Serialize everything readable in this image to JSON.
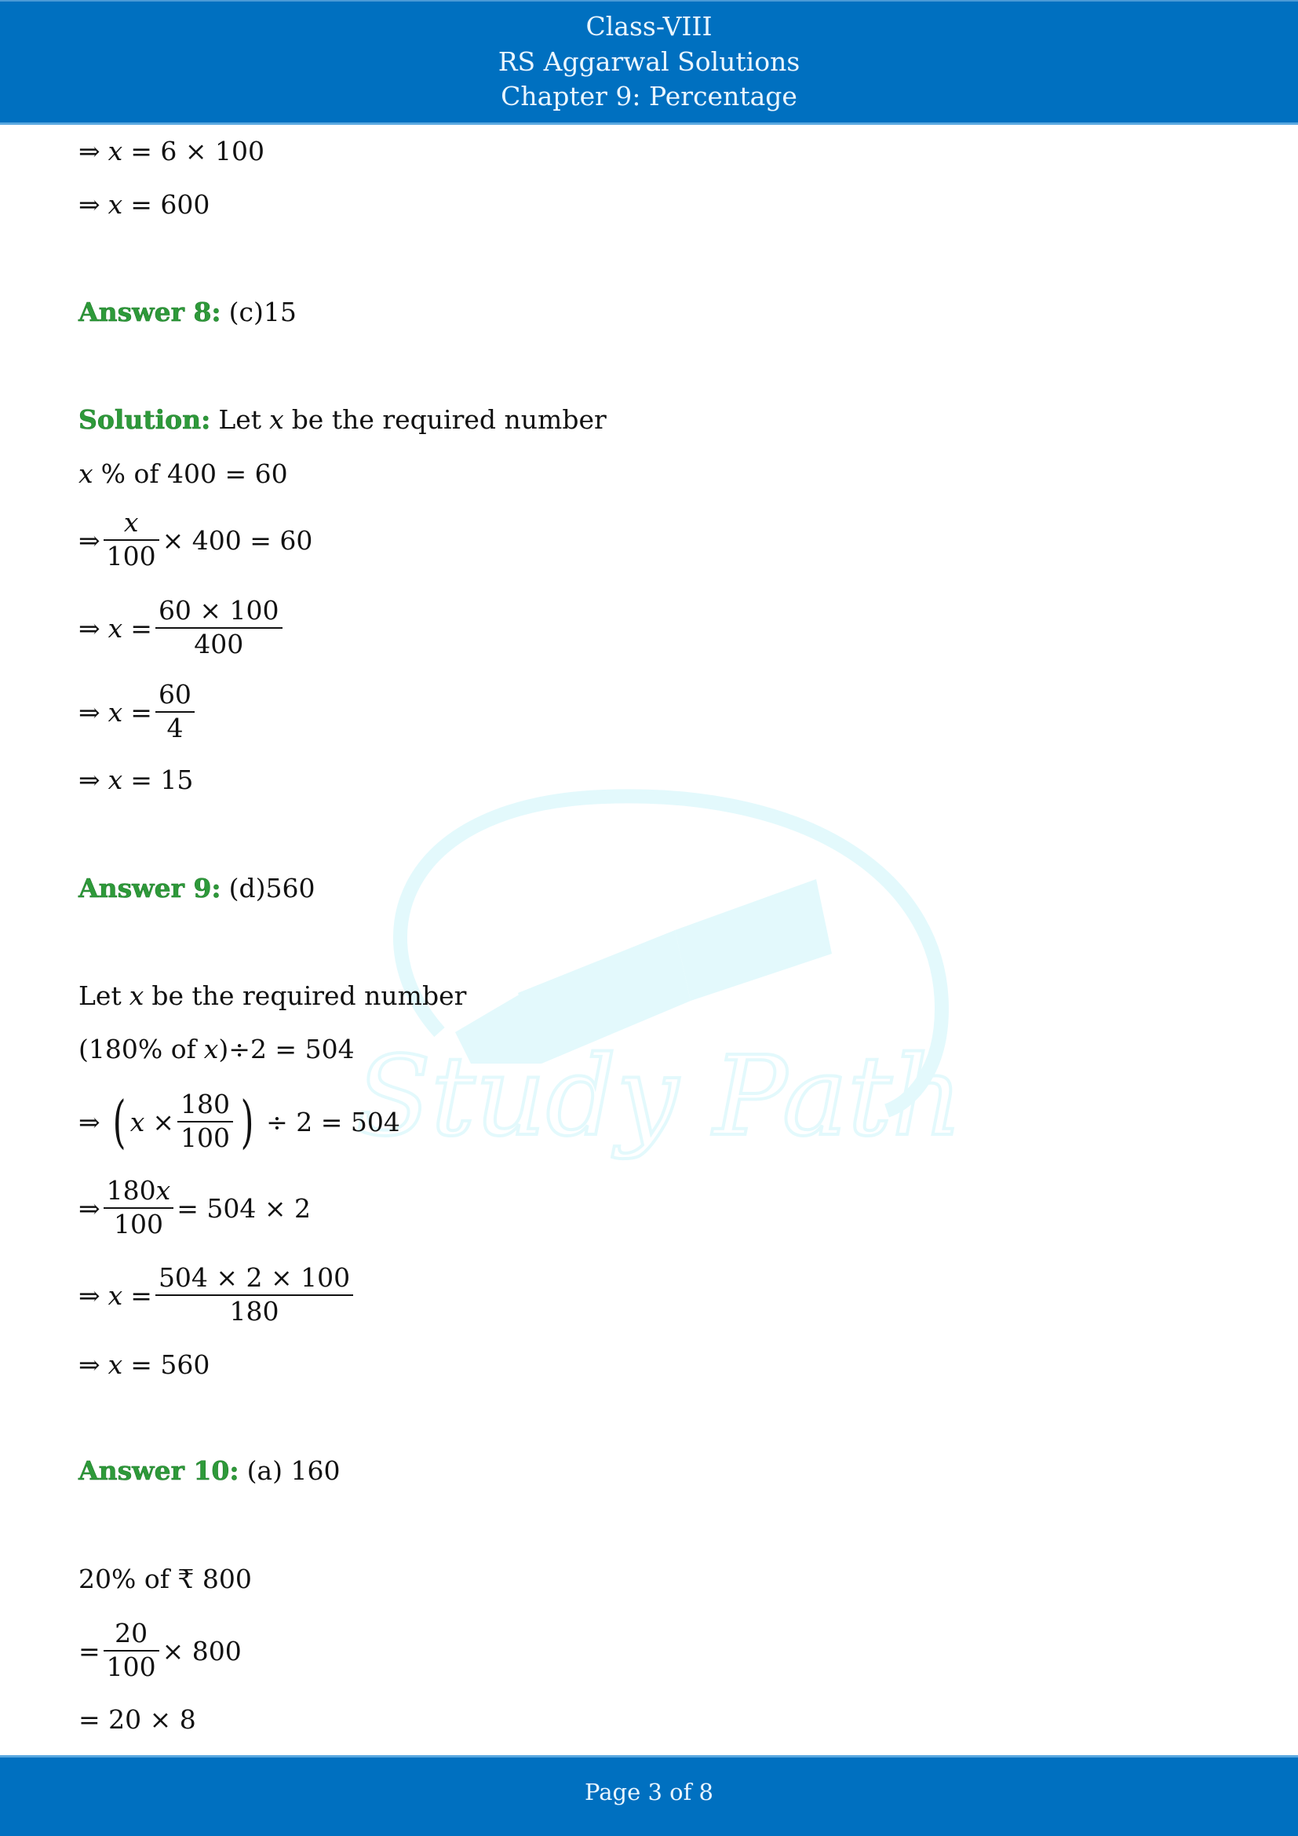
{
  "header": {
    "line1": "Class-VIII",
    "line2": "RS Aggarwal Solutions",
    "line3": "Chapter 9: Percentage",
    "background_color": "#0070c0"
  },
  "watermark": {
    "text": "Study Path",
    "icon": "fountain-pen-icon",
    "color": "#e3f9fc"
  },
  "content": {
    "prev": {
      "l1": {
        "arrow": "⇒",
        "var": "x",
        "rest": "= 6 × 100"
      },
      "l2": {
        "arrow": "⇒",
        "var": "x",
        "rest": "= 600"
      }
    },
    "a8": {
      "label": "Answer 8:",
      "value": "(c)15",
      "solution_label": "Solution:",
      "solution_pre": "Let",
      "solution_var": "x",
      "solution_post": "be the required number",
      "s1": {
        "var": "x",
        "rest": "% of 400 = 60"
      },
      "s2": {
        "arrow": "⇒",
        "num": "x",
        "den": "100",
        "rest": "× 400 = 60"
      },
      "s3": {
        "arrow": "⇒",
        "var": "x",
        "eq": "=",
        "num": "60 × 100",
        "den": "400"
      },
      "s4": {
        "arrow": "⇒",
        "var": "x",
        "eq": "=",
        "num": "60",
        "den": "4"
      },
      "s5": {
        "arrow": "⇒",
        "var": "x",
        "rest": "= 15"
      }
    },
    "a9": {
      "label": "Answer 9:",
      "value": "(d)560",
      "intro_pre": "Let",
      "intro_var": "x",
      "intro_post": "be the required number",
      "s1": {
        "pre": "(180% of",
        "var": "x",
        "post": ")÷2 = 504"
      },
      "s2": {
        "arrow": "⇒",
        "lparen": "(",
        "var": "x",
        "times": "×",
        "num": "180",
        "den": "100",
        "rparen": ")",
        "rest": "÷ 2 = 504"
      },
      "s3": {
        "arrow": "⇒",
        "num": "180",
        "num_var": "x",
        "den": "100",
        "rest": "= 504 × 2"
      },
      "s4": {
        "arrow": "⇒",
        "var": "x",
        "eq": "=",
        "num": "504 × 2 × 100",
        "den": "180"
      },
      "s5": {
        "arrow": "⇒",
        "var": "x",
        "rest": "= 560"
      }
    },
    "a10": {
      "label": "Answer 10:",
      "value": "(a) 160",
      "s1": "20% of ₹ 800",
      "s2": {
        "eq": "=",
        "num": "20",
        "den": "100",
        "rest": "× 800"
      },
      "s3": "= 20 × 8"
    }
  },
  "footer": {
    "page_label": "Page 3 of 8"
  }
}
